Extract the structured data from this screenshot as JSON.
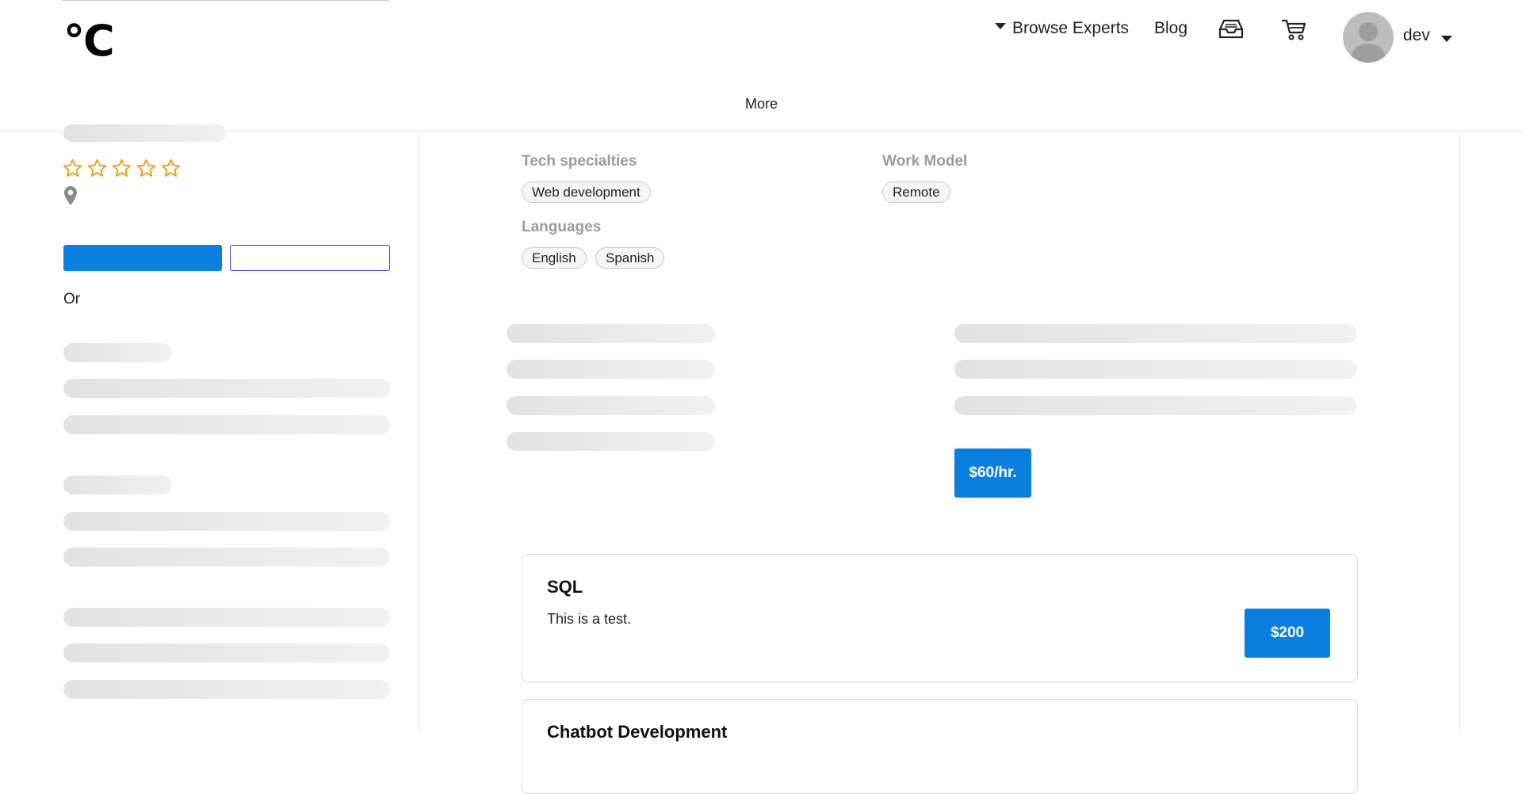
{
  "header": {
    "logo": "°C",
    "nav": {
      "browse_experts": "Browse Experts",
      "blog": "Blog"
    },
    "user": {
      "name": "dev"
    },
    "more": "More"
  },
  "sidebar": {
    "rating_stars": 5,
    "or_text": "Or"
  },
  "profile": {
    "tech_specialties_label": "Tech specialties",
    "tech_specialties": [
      "Web development"
    ],
    "work_model_label": "Work Model",
    "work_model": [
      "Remote"
    ],
    "languages_label": "Languages",
    "languages": [
      "English",
      "Spanish"
    ],
    "rate": "$60/hr."
  },
  "services": [
    {
      "title": "SQL",
      "description": "This is a test.",
      "price": "$200"
    },
    {
      "title": "Chatbot Development"
    }
  ],
  "colors": {
    "primary": "#0a7fe0",
    "star": "#f0a11b",
    "outline_button": "#3b3fd6",
    "skeleton": "#e2e2e2"
  }
}
